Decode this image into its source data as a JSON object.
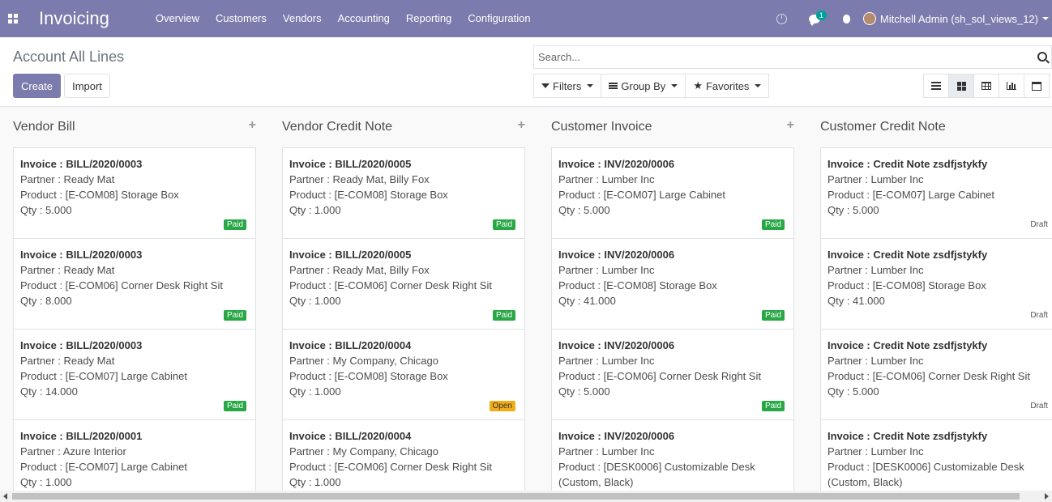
{
  "navbar": {
    "app_name": "Invoicing",
    "menu": [
      "Overview",
      "Customers",
      "Vendors",
      "Accounting",
      "Reporting",
      "Configuration"
    ],
    "messages_count": "1",
    "user_name": "Mitchell Admin (sh_sol_views_12)"
  },
  "control_panel": {
    "title": "Account All Lines",
    "create_label": "Create",
    "import_label": "Import",
    "search_placeholder": "Search...",
    "filters_label": "Filters",
    "group_by_label": "Group By",
    "favorites_label": "Favorites",
    "active_view": "kanban"
  },
  "columns": [
    {
      "title": "Vendor Bill",
      "cards": [
        {
          "invoice": "Invoice : BILL/2020/0003",
          "partner": "Partner : Ready Mat",
          "product": "Product : [E-COM08] Storage Box",
          "qty": "Qty : 5.000",
          "status": "Paid"
        },
        {
          "invoice": "Invoice : BILL/2020/0003",
          "partner": "Partner : Ready Mat",
          "product": "Product : [E-COM06] Corner Desk Right Sit",
          "qty": "Qty : 8.000",
          "status": "Paid"
        },
        {
          "invoice": "Invoice : BILL/2020/0003",
          "partner": "Partner : Ready Mat",
          "product": "Product : [E-COM07] Large Cabinet",
          "qty": "Qty : 14.000",
          "status": "Paid"
        },
        {
          "invoice": "Invoice : BILL/2020/0001",
          "partner": "Partner : Azure Interior",
          "product": "Product : [E-COM07] Large Cabinet",
          "qty": "Qty : 1.000",
          "status": ""
        }
      ]
    },
    {
      "title": "Vendor Credit Note",
      "cards": [
        {
          "invoice": "Invoice : BILL/2020/0005",
          "partner": "Partner : Ready Mat, Billy Fox",
          "product": "Product : [E-COM08] Storage Box",
          "qty": "Qty : 1.000",
          "status": "Paid"
        },
        {
          "invoice": "Invoice : BILL/2020/0005",
          "partner": "Partner : Ready Mat, Billy Fox",
          "product": "Product : [E-COM06] Corner Desk Right Sit",
          "qty": "Qty : 1.000",
          "status": "Paid"
        },
        {
          "invoice": "Invoice : BILL/2020/0004",
          "partner": "Partner : My Company, Chicago",
          "product": "Product : [E-COM08] Storage Box",
          "qty": "Qty : 1.000",
          "status": "Open"
        },
        {
          "invoice": "Invoice : BILL/2020/0004",
          "partner": "Partner : My Company, Chicago",
          "product": "Product : [E-COM06] Corner Desk Right Sit",
          "qty": "Qty : 1.000",
          "status": ""
        }
      ]
    },
    {
      "title": "Customer Invoice",
      "cards": [
        {
          "invoice": "Invoice : INV/2020/0006",
          "partner": "Partner : Lumber Inc",
          "product": "Product : [E-COM07] Large Cabinet",
          "qty": "Qty : 5.000",
          "status": "Paid"
        },
        {
          "invoice": "Invoice : INV/2020/0006",
          "partner": "Partner : Lumber Inc",
          "product": "Product : [E-COM08] Storage Box",
          "qty": "Qty : 41.000",
          "status": "Paid"
        },
        {
          "invoice": "Invoice : INV/2020/0006",
          "partner": "Partner : Lumber Inc",
          "product": "Product : [E-COM06] Corner Desk Right Sit",
          "qty": "Qty : 5.000",
          "status": "Paid"
        },
        {
          "invoice": "Invoice : INV/2020/0006",
          "partner": "Partner : Lumber Inc",
          "product": "Product : [DESK0006] Customizable Desk",
          "qty": "(Custom, Black)",
          "status": ""
        }
      ]
    },
    {
      "title": "Customer Credit Note",
      "cards": [
        {
          "invoice": "Invoice : Credit Note zsdfjstykfy",
          "partner": "Partner : Lumber Inc",
          "product": "Product : [E-COM07] Large Cabinet",
          "qty": "Qty : 5.000",
          "status": "Draft"
        },
        {
          "invoice": "Invoice : Credit Note zsdfjstykfy",
          "partner": "Partner : Lumber Inc",
          "product": "Product : [E-COM08] Storage Box",
          "qty": "Qty : 41.000",
          "status": "Draft"
        },
        {
          "invoice": "Invoice : Credit Note zsdfjstykfy",
          "partner": "Partner : Lumber Inc",
          "product": "Product : [E-COM06] Corner Desk Right Sit",
          "qty": "Qty : 5.000",
          "status": "Draft"
        },
        {
          "invoice": "Invoice : Credit Note zsdfjstykfy",
          "partner": "Partner : Lumber Inc",
          "product": "Product : [DESK0006] Customizable Desk",
          "qty": "(Custom, Black)",
          "status": ""
        }
      ]
    }
  ],
  "colors": {
    "navbar": "#7c7bad",
    "paid": "#28a745",
    "open": "#f0ad18"
  }
}
